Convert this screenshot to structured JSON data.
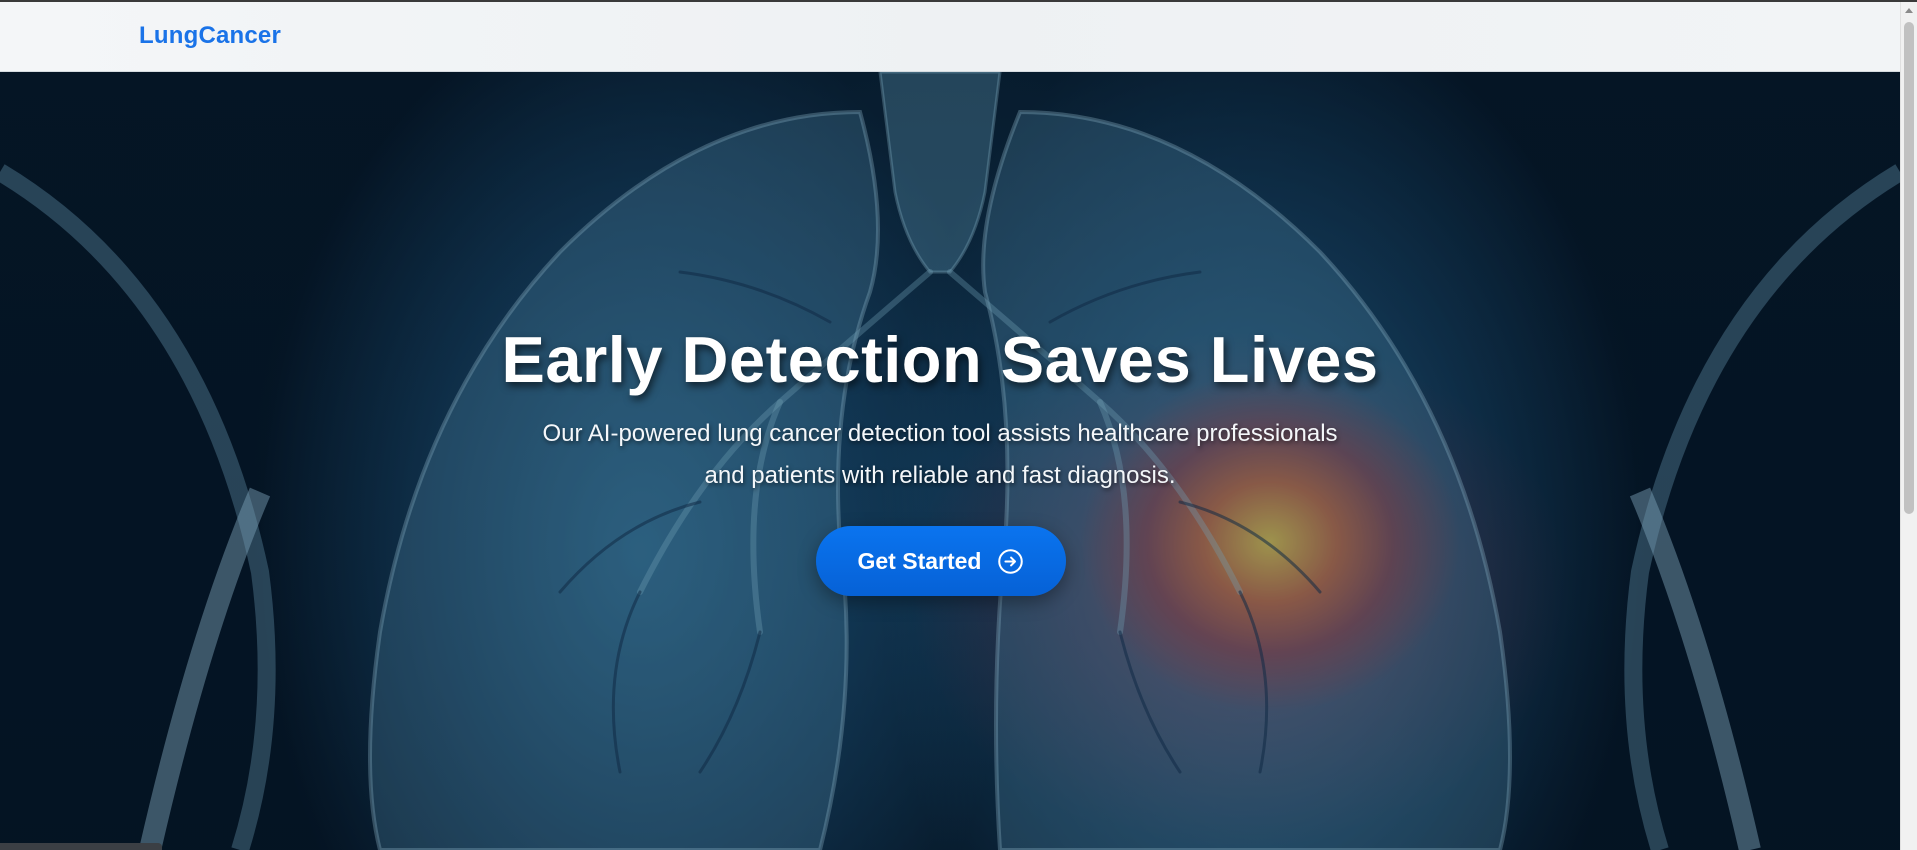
{
  "navbar": {
    "brand": "LungCancer"
  },
  "hero": {
    "headline": "Early Detection Saves Lives",
    "subtitle_line1": "Our AI-powered lung cancer detection tool assists healthcare professionals",
    "subtitle_line2": "and patients with reliable and fast diagnosis.",
    "cta_label": "Get Started",
    "cta_icon": "arrow-right-circle-icon",
    "background": "x-ray lungs with tumor highlight"
  },
  "colors": {
    "brand": "#1a73e8",
    "cta": "#0a74ef",
    "headline": "#ffffff"
  }
}
